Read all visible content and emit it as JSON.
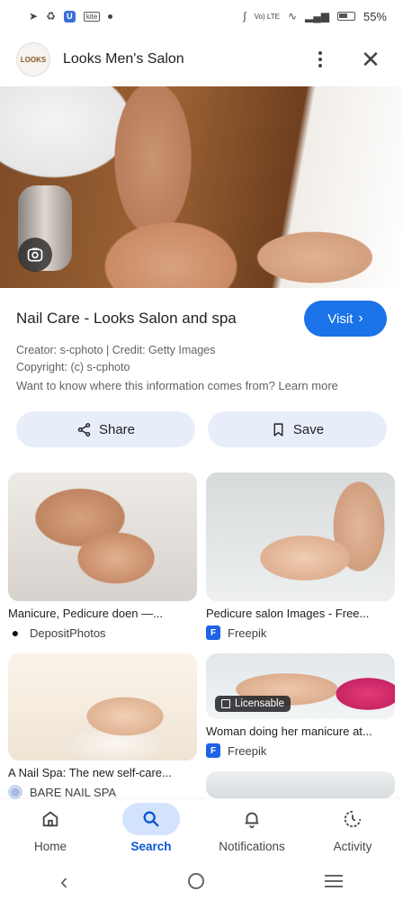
{
  "status_bar": {
    "icons_left": [
      "telegram-icon",
      "sync-icon",
      "app-icon",
      "news-icon",
      "dot-icon"
    ],
    "app_box": "U",
    "tiny_badge": "kite",
    "network": "Vo) LTE",
    "battery": "55%"
  },
  "header": {
    "site_name": "Looks Men's Salon",
    "logo_text": "LOOKS"
  },
  "result": {
    "title": "Nail Care - Looks Salon and spa",
    "visit_label": "Visit",
    "creator_line": "Creator: s-cphoto | Credit: Getty Images",
    "copyright_line": "Copyright: (c) s-cphoto",
    "learn_more": "Want to know where this information comes from? Learn more",
    "share_label": "Share",
    "save_label": "Save"
  },
  "related": [
    {
      "caption": "Manicure, Pedicure doen —...",
      "source": "DepositPhotos"
    },
    {
      "caption": "Pedicure salon Images - Free...",
      "source": "Freepik"
    },
    {
      "caption": "A Nail Spa: The new self-care...",
      "source": "BARE NAIL SPA"
    },
    {
      "caption": "Woman doing her manicure at...",
      "source": "Freepik",
      "badge": "Licensable"
    }
  ],
  "bottom_nav": [
    {
      "label": "Home",
      "icon": "home-icon",
      "active": false
    },
    {
      "label": "Search",
      "icon": "search-icon",
      "active": true
    },
    {
      "label": "Notifications",
      "icon": "bell-icon",
      "active": false
    },
    {
      "label": "Activity",
      "icon": "activity-icon",
      "active": false
    }
  ],
  "colors": {
    "accent": "#1a73e8",
    "chip_bg": "#e8eef9",
    "nav_active_bg": "#d3e3fd",
    "nav_active_text": "#0b57d0"
  }
}
